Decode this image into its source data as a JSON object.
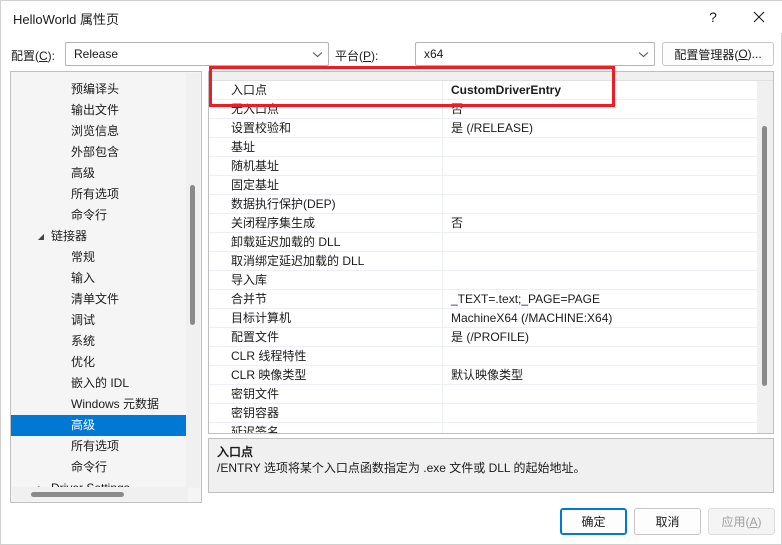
{
  "window": {
    "title": "HelloWorld 属性页",
    "help_icon": "question-mark-icon",
    "close_icon": "close-icon"
  },
  "toolbar": {
    "config_label": "配置(C):",
    "config_value": "Release",
    "platform_label": "平台(P):",
    "platform_value": "x64",
    "config_manager_button": "配置管理器(O)..."
  },
  "tree": {
    "items": [
      {
        "label": "预编译头",
        "level": 2,
        "twisty": "",
        "selected": false
      },
      {
        "label": "输出文件",
        "level": 2,
        "twisty": "",
        "selected": false
      },
      {
        "label": "浏览信息",
        "level": 2,
        "twisty": "",
        "selected": false
      },
      {
        "label": "外部包含",
        "level": 2,
        "twisty": "",
        "selected": false
      },
      {
        "label": "高级",
        "level": 2,
        "twisty": "",
        "selected": false
      },
      {
        "label": "所有选项",
        "level": 2,
        "twisty": "",
        "selected": false
      },
      {
        "label": "命令行",
        "level": 2,
        "twisty": "",
        "selected": false
      },
      {
        "label": "链接器",
        "level": 1,
        "twisty": "▲",
        "selected": false
      },
      {
        "label": "常规",
        "level": 2,
        "twisty": "",
        "selected": false
      },
      {
        "label": "输入",
        "level": 2,
        "twisty": "",
        "selected": false
      },
      {
        "label": "清单文件",
        "level": 2,
        "twisty": "",
        "selected": false
      },
      {
        "label": "调试",
        "level": 2,
        "twisty": "",
        "selected": false
      },
      {
        "label": "系统",
        "level": 2,
        "twisty": "",
        "selected": false
      },
      {
        "label": "优化",
        "level": 2,
        "twisty": "",
        "selected": false
      },
      {
        "label": "嵌入的 IDL",
        "level": 2,
        "twisty": "",
        "selected": false
      },
      {
        "label": "Windows 元数据",
        "level": 2,
        "twisty": "",
        "selected": false
      },
      {
        "label": "高级",
        "level": 2,
        "twisty": "",
        "selected": true
      },
      {
        "label": "所有选项",
        "level": 2,
        "twisty": "",
        "selected": false
      },
      {
        "label": "命令行",
        "level": 2,
        "twisty": "",
        "selected": false
      },
      {
        "label": "Driver Settings",
        "level": 1,
        "twisty": "▶",
        "selected": false
      }
    ]
  },
  "grid": {
    "rows": [
      {
        "name": "入口点",
        "value": "CustomDriverEntry",
        "highlight": true
      },
      {
        "name": "无入口点",
        "value": "否",
        "highlight": false
      },
      {
        "name": "设置校验和",
        "value": "是 (/RELEASE)",
        "highlight": false
      },
      {
        "name": "基址",
        "value": "",
        "highlight": false
      },
      {
        "name": "随机基址",
        "value": "",
        "highlight": false
      },
      {
        "name": "固定基址",
        "value": "",
        "highlight": false
      },
      {
        "name": "数据执行保护(DEP)",
        "value": "",
        "highlight": false
      },
      {
        "name": "关闭程序集生成",
        "value": "否",
        "highlight": false
      },
      {
        "name": "卸载延迟加载的 DLL",
        "value": "",
        "highlight": false
      },
      {
        "name": "取消绑定延迟加载的 DLL",
        "value": "",
        "highlight": false
      },
      {
        "name": "导入库",
        "value": "",
        "highlight": false
      },
      {
        "name": "合并节",
        "value": "_TEXT=.text;_PAGE=PAGE",
        "highlight": false
      },
      {
        "name": "目标计算机",
        "value": "MachineX64 (/MACHINE:X64)",
        "highlight": false
      },
      {
        "name": "配置文件",
        "value": "是 (/PROFILE)",
        "highlight": false
      },
      {
        "name": "CLR 线程特性",
        "value": "",
        "highlight": false
      },
      {
        "name": "CLR 映像类型",
        "value": "默认映像类型",
        "highlight": false
      },
      {
        "name": "密钥文件",
        "value": "",
        "highlight": false
      },
      {
        "name": "密钥容器",
        "value": "",
        "highlight": false
      },
      {
        "name": "延迟签名",
        "value": "",
        "highlight": false
      }
    ]
  },
  "description": {
    "title": "入口点",
    "body": "/ENTRY 选项将某个入口点函数指定为 .exe 文件或 DLL 的起始地址。"
  },
  "footer": {
    "ok": "确定",
    "cancel": "取消",
    "apply": "应用(A)"
  },
  "colors": {
    "accent": "#0078d4",
    "highlight_box": "#ee1c25",
    "panel_bg": "#f0f0f0"
  }
}
